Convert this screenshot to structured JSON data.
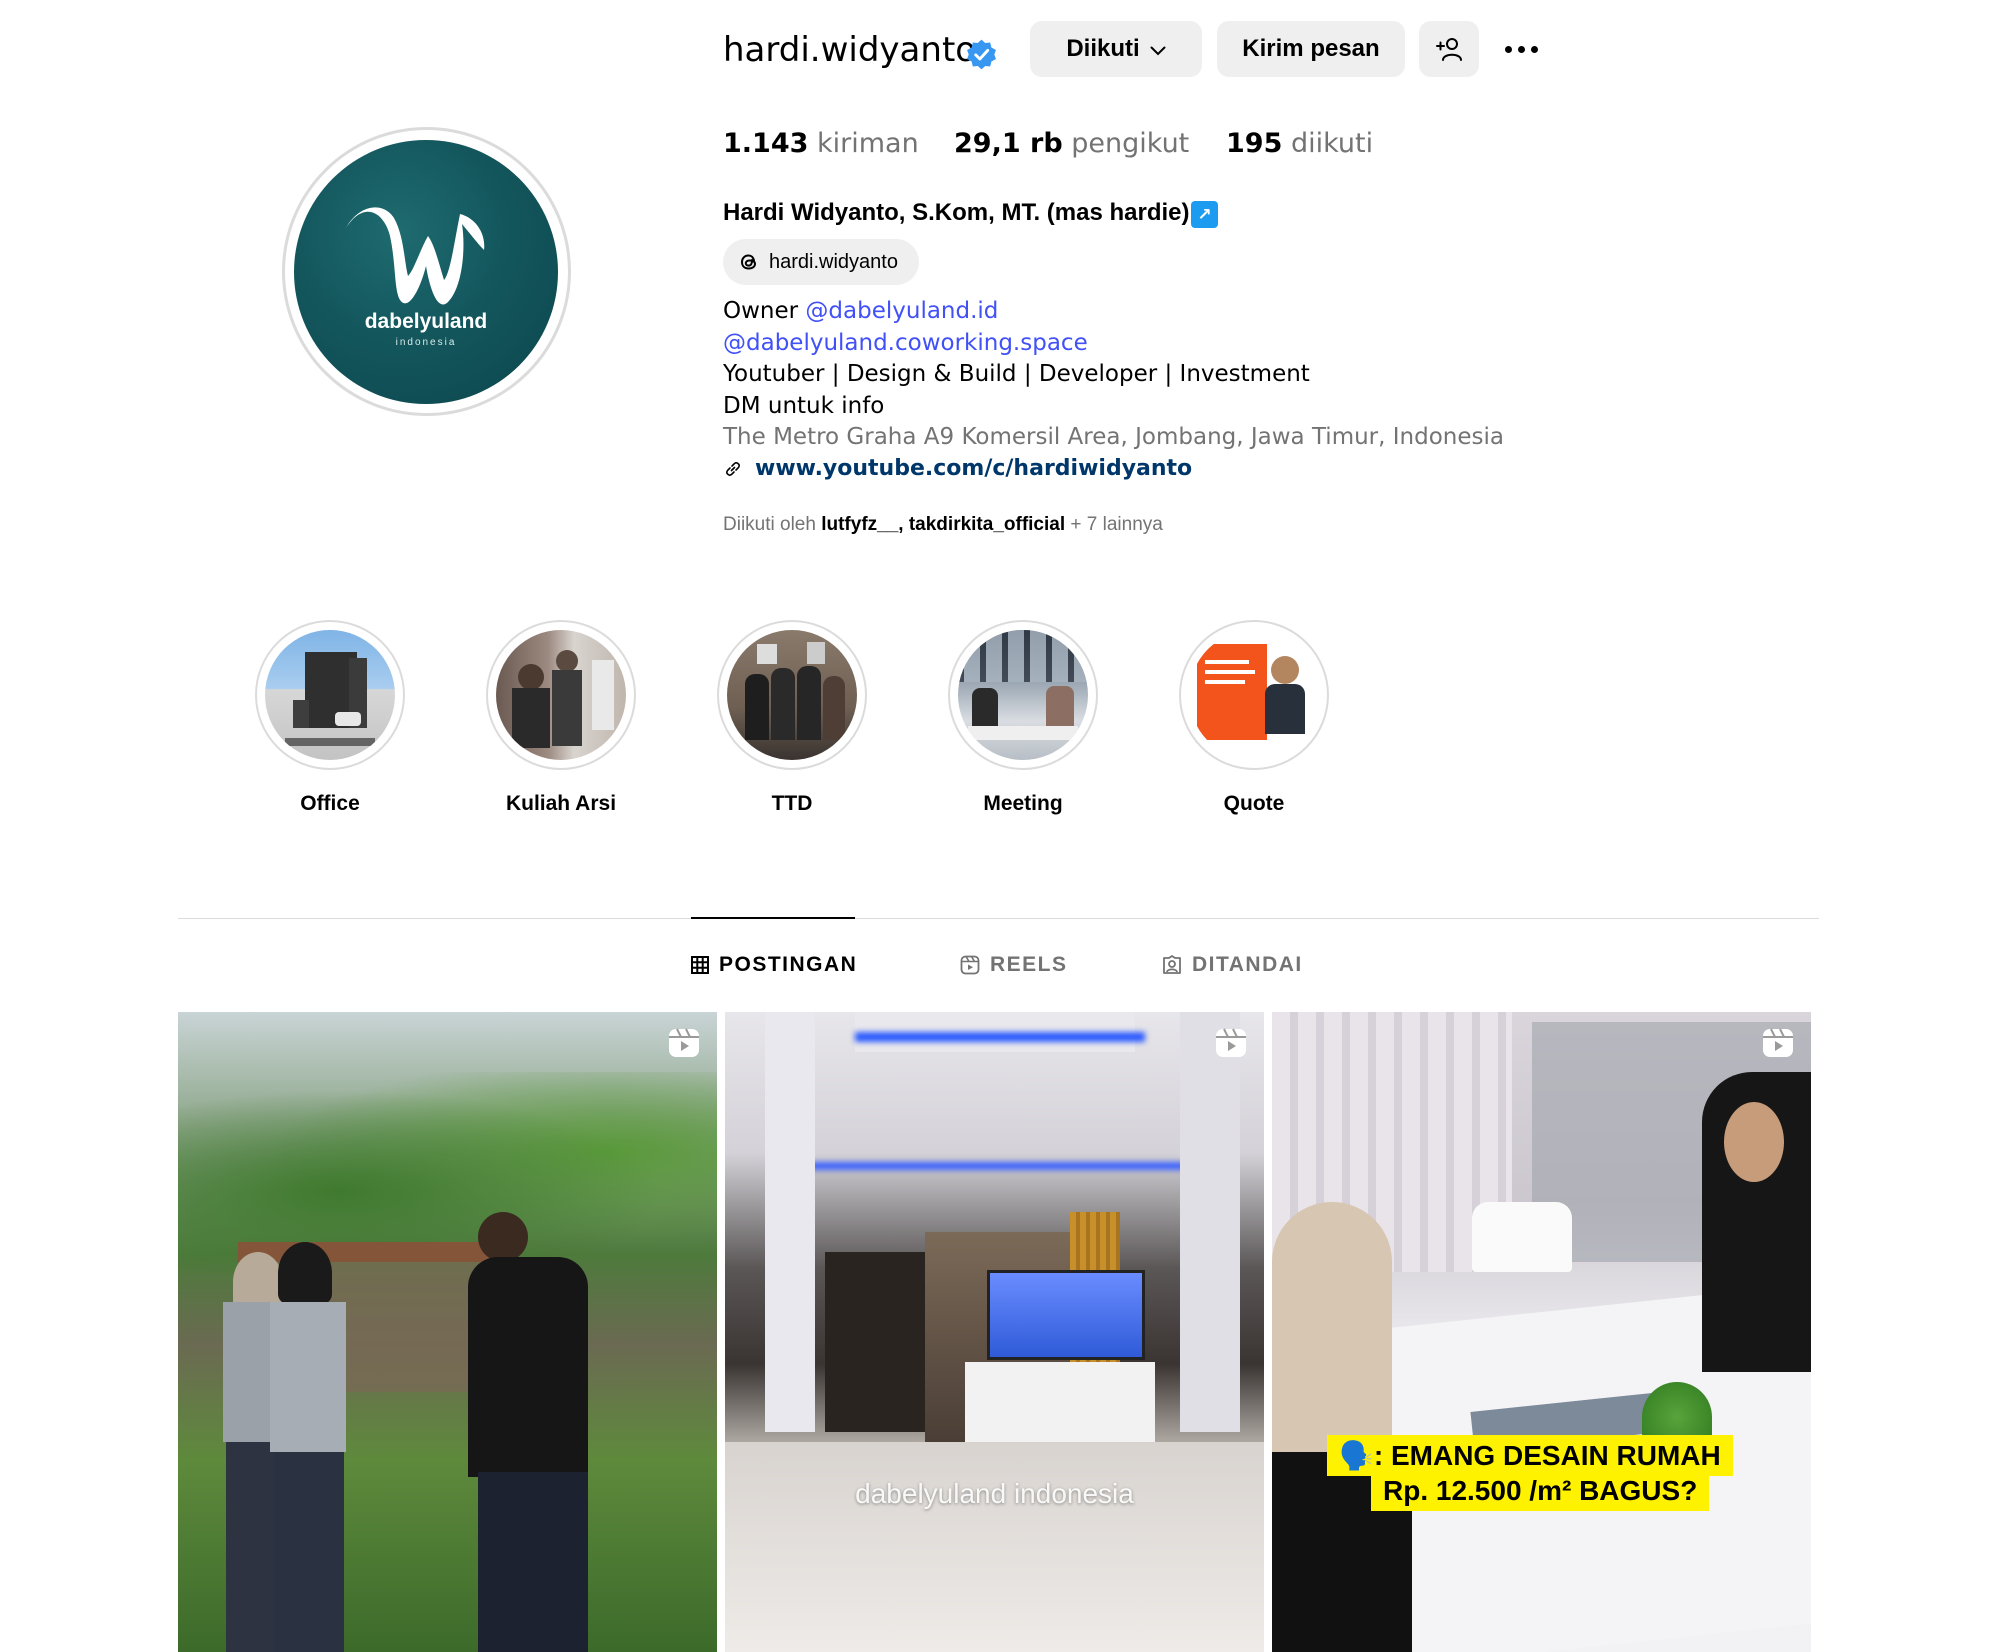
{
  "profile": {
    "username": "hardi.widyanto",
    "follow_button": "Diikuti",
    "message_button": "Kirim pesan",
    "stats": {
      "posts_value": "1.143",
      "posts_label": "kiriman",
      "followers_value": "29,1 rb",
      "followers_label": "pengikut",
      "following_value": "195",
      "following_label": "diikuti"
    },
    "full_name": "Hardi Widyanto, S.Kom, MT. (mas hardie)",
    "threads_handle": "hardi.widyanto",
    "bio": {
      "owner_prefix": "Owner ",
      "owner_mention": "@dabelyuland.id",
      "line2_mention": "@dabelyuland.coworking.space",
      "line3": "Youtuber | Design & Build | Developer | Investment",
      "line4": "DM untuk info",
      "address": "The Metro Graha A9 Komersil Area, Jombang, Jawa Timur, Indonesia",
      "link": "www.youtube.com/c/hardiwidyanto"
    },
    "followed_by": {
      "prefix": "Diikuti oleh ",
      "users": "lutfyfz__, takdirkita_official",
      "suffix": " + 7 lainnya"
    },
    "avatar": {
      "brand_text": "dabelyuland",
      "sub_text": "indonesia"
    }
  },
  "highlights": [
    {
      "label": "Office"
    },
    {
      "label": "Kuliah Arsi"
    },
    {
      "label": "TTD"
    },
    {
      "label": "Meeting"
    },
    {
      "label": "Quote"
    }
  ],
  "tabs": {
    "posts": "POSTINGAN",
    "reels": "REELS",
    "tagged": "DITANDAI"
  },
  "posts": [
    {
      "type": "reel",
      "caption": ""
    },
    {
      "type": "reel",
      "caption": "dabelyuland indonesia"
    },
    {
      "type": "reel",
      "caption_line1": "🗣️: EMANG DESAIN RUMAH",
      "caption_line2": "Rp. 12.500 /m² BAGUS?"
    }
  ],
  "colors": {
    "verified": "#3897f0",
    "mention": "#4150f7",
    "link": "#00376b",
    "button_bg": "#efefef",
    "avatar_bg": "#13575d",
    "muted_text": "#737373"
  },
  "icons": [
    "verified-badge-icon",
    "chevron-down-icon",
    "add-user-icon",
    "more-options-icon",
    "threads-icon",
    "external-link-icon",
    "link-icon",
    "grid-icon",
    "reels-icon",
    "tagged-icon",
    "reel-indicator-icon"
  ]
}
